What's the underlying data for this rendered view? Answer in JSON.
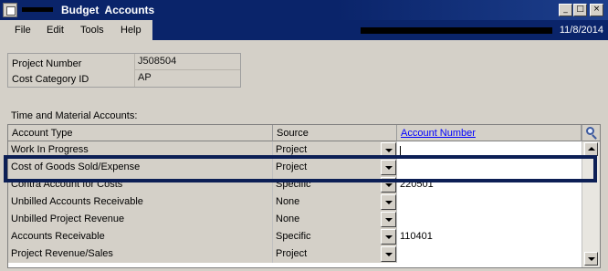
{
  "window": {
    "title": "Budget  Accounts",
    "date": "11/8/2014",
    "buttons": {
      "minimize": "_",
      "maximize": "□",
      "close": "×"
    }
  },
  "menu": {
    "items": [
      "File",
      "Edit",
      "Tools",
      "Help"
    ]
  },
  "project": {
    "number_label": "Project Number",
    "number_value": "J508504",
    "category_label": "Cost Category ID",
    "category_value": "AP"
  },
  "section_label": "Time and Material Accounts:",
  "grid": {
    "headers": {
      "type": "Account Type",
      "source": "Source",
      "account": "Account Number"
    },
    "rows": [
      {
        "type": "Work In Progress",
        "source": "Project",
        "account": ""
      },
      {
        "type": "Cost of Goods Sold/Expense",
        "source": "Project",
        "account": ""
      },
      {
        "type": "Contra Account for Costs",
        "source": "Specific",
        "account": "220501"
      },
      {
        "type": "Unbilled Accounts Receivable",
        "source": "None",
        "account": ""
      },
      {
        "type": "Unbilled Project Revenue",
        "source": "None",
        "account": ""
      },
      {
        "type": "Accounts Receivable",
        "source": "Specific",
        "account": "110401"
      },
      {
        "type": "Project Revenue/Sales",
        "source": "Project",
        "account": ""
      }
    ]
  },
  "colors": {
    "titlebar": "#0a246a",
    "highlight_border": "#0c1f55",
    "link": "#0000ff",
    "face": "#d4d0c8"
  }
}
